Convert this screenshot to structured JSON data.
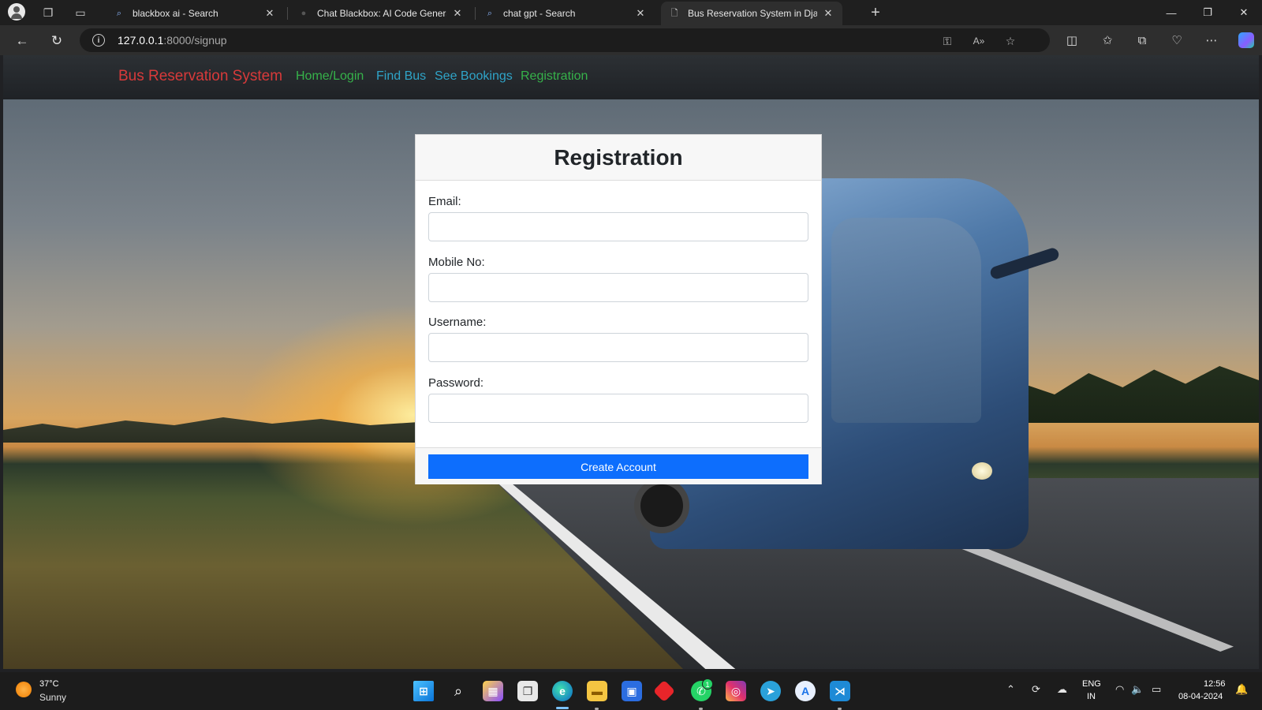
{
  "browser": {
    "tabs": [
      {
        "title": "blackbox ai - Search",
        "icon": "search-icon"
      },
      {
        "title": "Chat Blackbox: AI Code Generatio",
        "icon": "blackbox-icon"
      },
      {
        "title": "chat gpt - Search",
        "icon": "search-icon"
      },
      {
        "title": "Bus Reservation System in Djang",
        "icon": "page-icon",
        "active": true
      }
    ],
    "url_host": "127.0.0.1",
    "url_path": ":8000/signup"
  },
  "site": {
    "brand": "Bus Reservation System",
    "nav": [
      {
        "label": "Home/Login",
        "color": "#36b24a"
      },
      {
        "label": "Find Bus",
        "color": "#2fa4c8"
      },
      {
        "label": "See Bookings",
        "color": "#2fa4c8"
      },
      {
        "label": "Registration",
        "color": "#36b24a"
      }
    ],
    "brand_color": "#d83a3a"
  },
  "form": {
    "title": "Registration",
    "fields": [
      {
        "label": "Email:",
        "value": ""
      },
      {
        "label": "Mobile No:",
        "value": ""
      },
      {
        "label": "Username:",
        "value": ""
      },
      {
        "label": "Password:",
        "value": ""
      }
    ],
    "submit_label": "Create Account",
    "submit_color": "#0d6efd"
  },
  "taskbar": {
    "weather_temp": "37°C",
    "weather_condition": "Sunny",
    "lang_line1": "ENG",
    "lang_line2": "IN",
    "time": "12:56",
    "date": "08-04-2024",
    "whatsapp_badge": "1"
  }
}
